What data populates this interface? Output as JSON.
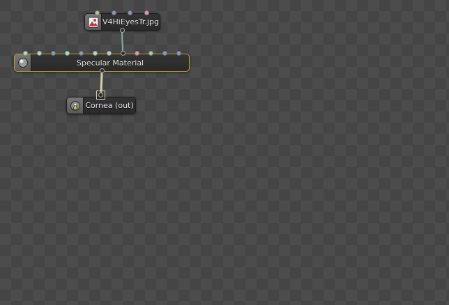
{
  "nodes": {
    "image": {
      "label": "V4HiEyesTr.jpg",
      "icon": "image-texture-icon",
      "selected": false
    },
    "material": {
      "label": "Specular Material",
      "icon": "sphere-material-icon",
      "selected": true
    },
    "output": {
      "label": "Cornea (out)",
      "icon": "output-lamp-icon",
      "selected": false
    }
  },
  "colors": {
    "canvas": "#454545",
    "node_body": "#2e2e2e",
    "selection_outline": "#c9a227",
    "link_image_material": "#7fb0a0",
    "link_material_output": "#d8cfa8"
  }
}
